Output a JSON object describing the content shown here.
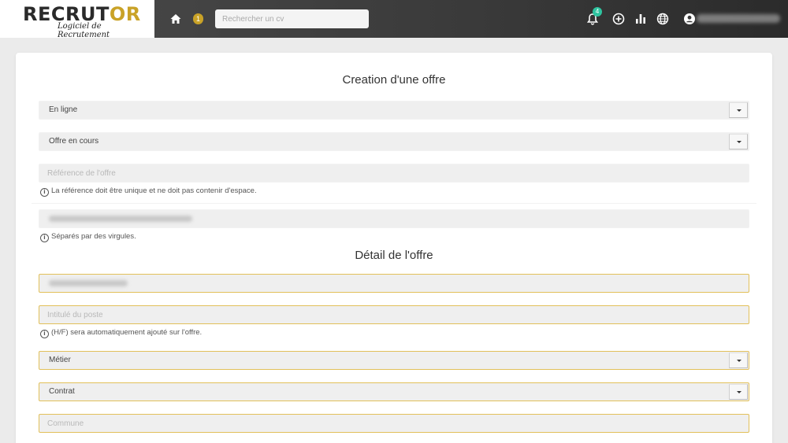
{
  "header": {
    "logo_text_dark": "RECRUT",
    "logo_text_gold": "OR",
    "logo_subtitle": "Logiciel de Recrutement",
    "pending_count": "1",
    "search_placeholder": "Rechercher un cv",
    "notifications_count": "4",
    "icons": [
      "home-icon",
      "bell-icon",
      "plus-circle-icon",
      "bar-chart-icon",
      "globe-icon",
      "user-icon"
    ],
    "accent_color": "#c9a227",
    "notif_color": "#2ec4a0"
  },
  "form": {
    "title": "Creation d'une offre",
    "status_value": "En ligne",
    "state_value": "Offre en cours",
    "reference_placeholder": "Référence de l'offre",
    "reference_help": "La référence doit être unique et ne doit pas contenir d'espace.",
    "tags_help": "Séparés par des virgules.",
    "detail_title": "Détail de l'offre",
    "job_title_placeholder": "Intitulé du poste",
    "job_title_help": "(H/F) sera automatiquement ajouté sur l'offre.",
    "metier_value": "Métier",
    "contrat_value": "Contrat",
    "commune_placeholder": "Commune"
  }
}
